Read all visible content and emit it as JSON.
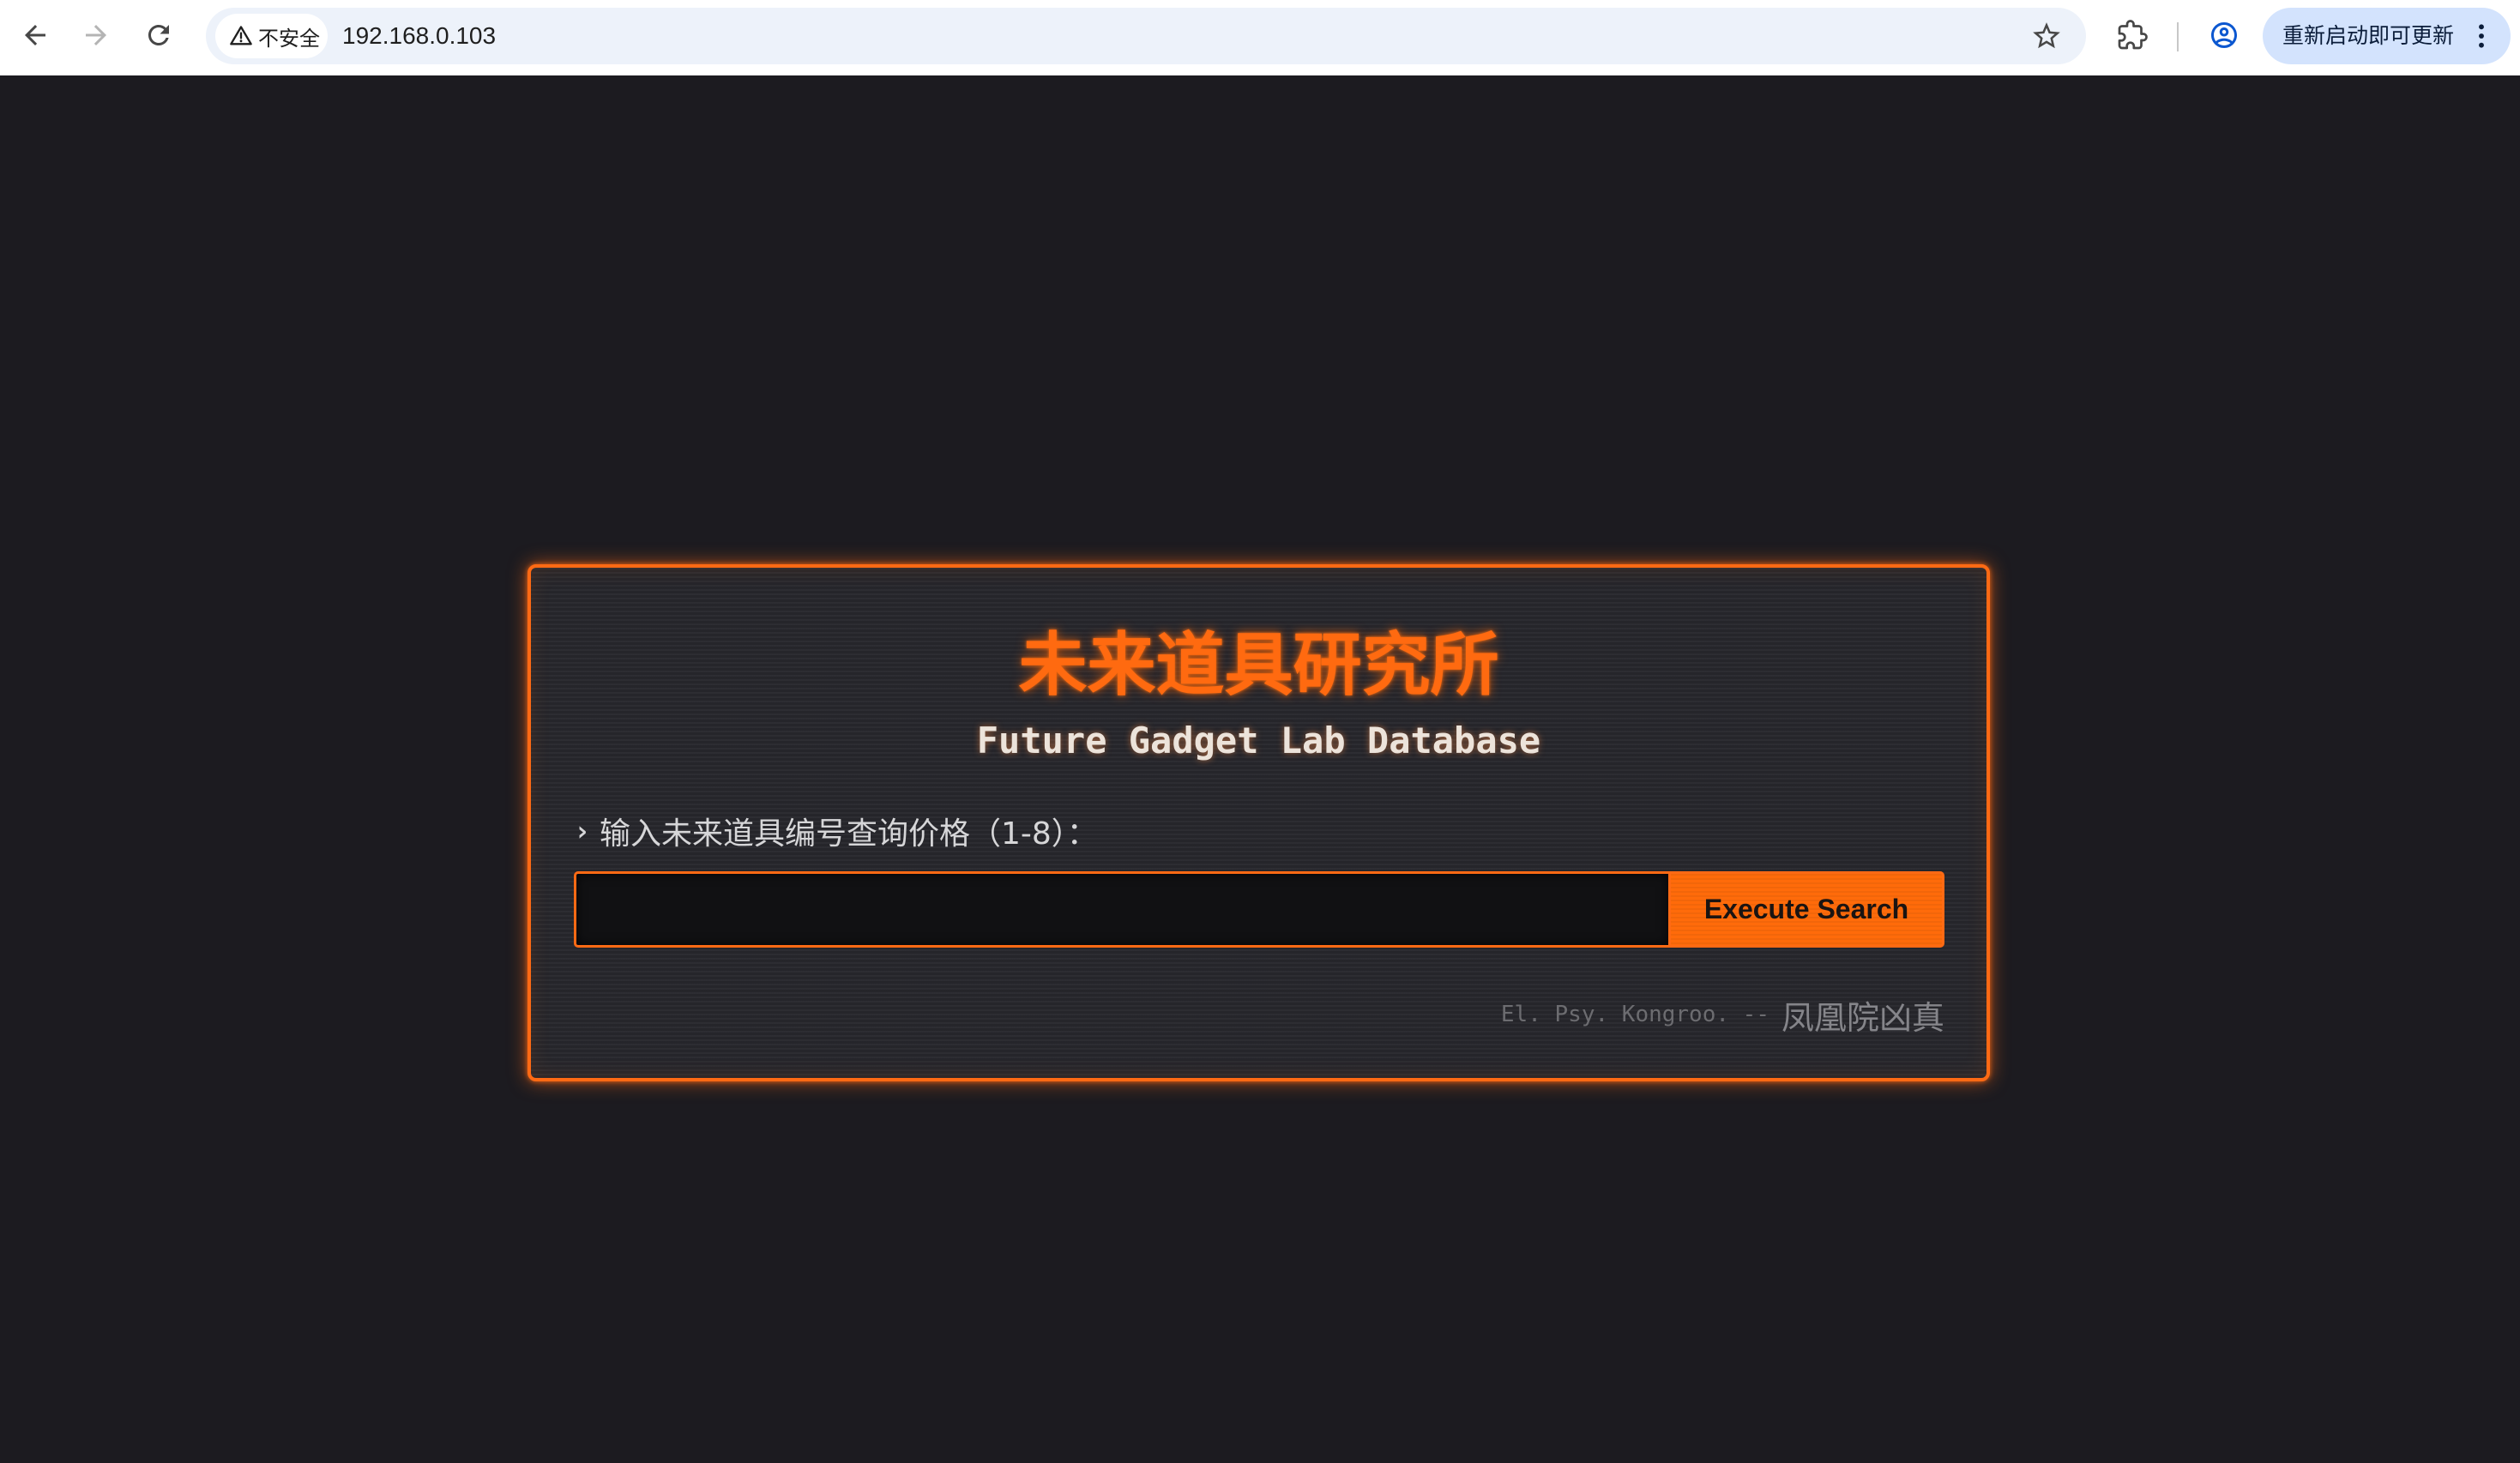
{
  "browser": {
    "icons": {
      "back": "arrow-left-icon",
      "forward": "arrow-right-icon",
      "reload": "reload-icon",
      "security": "warning-triangle-icon",
      "bookmark": "star-icon",
      "extensions": "puzzle-icon",
      "profile": "account-circle-icon",
      "menu": "kebab-menu-icon"
    },
    "security_chip": {
      "label": "不安全"
    },
    "url": "192.168.0.103",
    "update_button": {
      "label": "重新启动即可更新"
    }
  },
  "page": {
    "title": "未来道具研究所",
    "subtitle": "Future Gadget Lab Database",
    "prompt": {
      "chevron": "›",
      "text": "输入未来道具编号查询价格（1-8）："
    },
    "search": {
      "value": "",
      "button_label": "Execute Search"
    },
    "footer": {
      "quote": "El. Psy. Kongroo. --",
      "signature": "凤凰院凶真"
    }
  },
  "colors": {
    "accent": "#ff6a14",
    "page_background": "#1c1b20",
    "panel_background": "#25252a",
    "input_background": "#111113",
    "toolbar_background": "#ffffff",
    "omnibox_background": "#edf2fa",
    "update_pill_background": "#d3e3fd"
  }
}
